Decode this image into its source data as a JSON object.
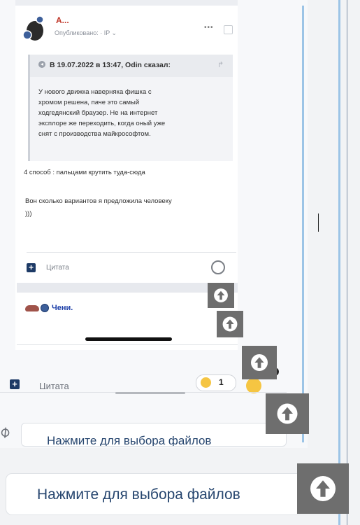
{
  "post": {
    "author": "А...",
    "published": "Опубликовано: · IP ⌄",
    "more": "•••"
  },
  "quote": {
    "title": "В 19.07.2022 в 13:47, Odin сказал:",
    "lines": [
      "У нового движка наверняка фишка с",
      "хромом решена, паче это самый",
      "ходгедянский браузер. Не на интернет",
      "эксплоре же переходить, когда оный уже",
      "снят с производства майкрософтом."
    ]
  },
  "body": {
    "line1": "4 способ : пальцами  крутить  туда-сюда",
    "line2": "Вон сколько вариантов я предложила человеку",
    "line3": ")))"
  },
  "actions": {
    "plus": "+",
    "quote_label": "Цитата"
  },
  "next_post": {
    "author": "Чени."
  },
  "reactions": {
    "count": "1"
  },
  "upload": {
    "small_label": "Нажмите для выбора файлов",
    "label": "Нажмите для выбора файлов"
  },
  "icons": {
    "scroll_top": "arrow-up-circle-icon",
    "attach": "paperclip-icon",
    "like": "heart-icon"
  },
  "colors": {
    "author": "#c0392b",
    "link": "#27466f",
    "scroll_button": "#6e6e6e",
    "accent_line": "#9cc4e6"
  }
}
